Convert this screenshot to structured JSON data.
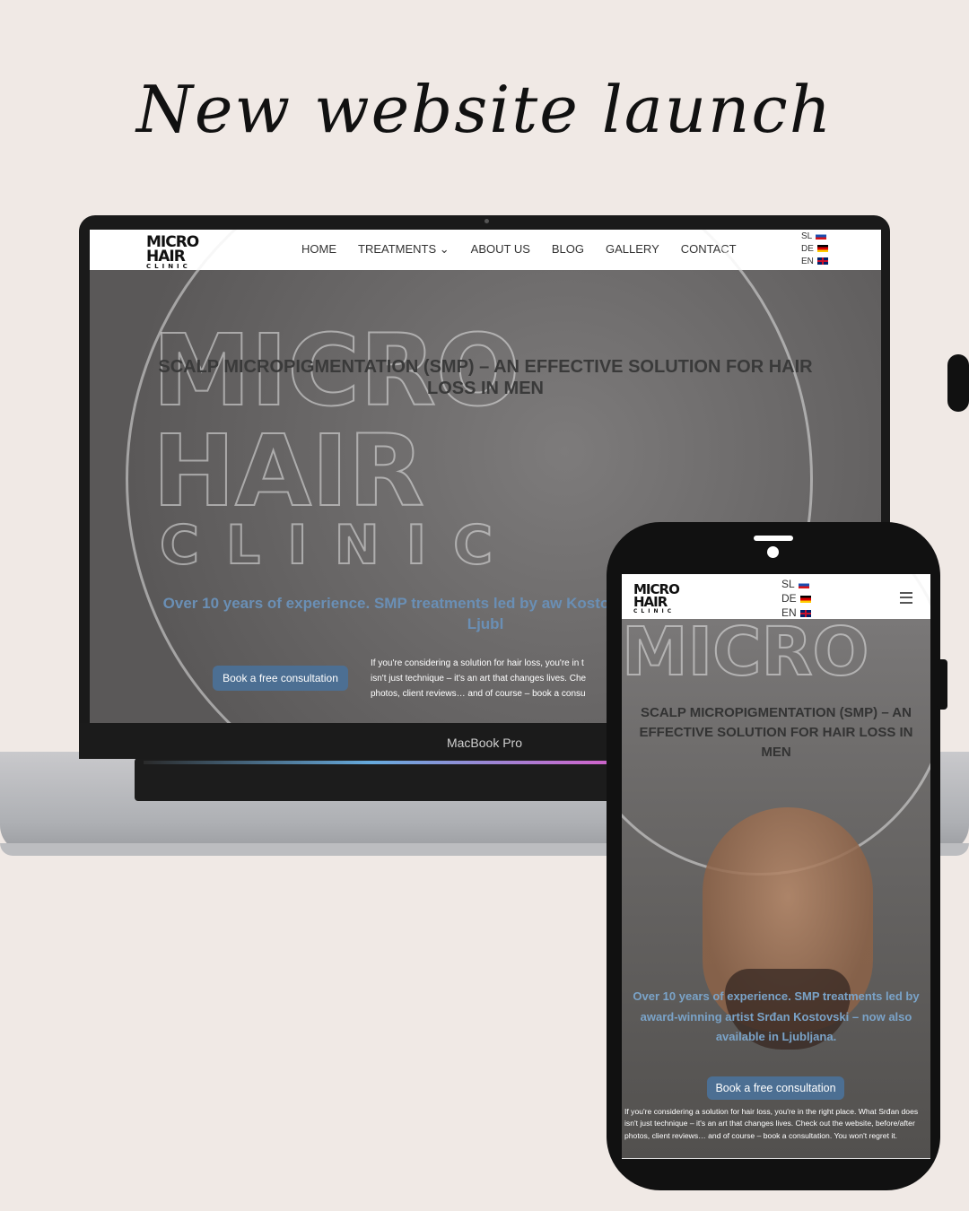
{
  "headline": "New website launch",
  "brand": {
    "line1": "MICRO",
    "line2": "HAIR",
    "line3": "CLINIC"
  },
  "desktop": {
    "nav": [
      {
        "label": "HOME"
      },
      {
        "label": "TREATMENTS ⌄"
      },
      {
        "label": "ABOUT US"
      },
      {
        "label": "BLOG"
      },
      {
        "label": "GALLERY"
      },
      {
        "label": "CONTACT"
      }
    ],
    "languages": [
      "SL",
      "DE",
      "EN"
    ],
    "hero_title": "SCALP MICROPIGMENTATION (SMP) – AN EFFECTIVE SOLUTION FOR HAIR LOSS IN MEN",
    "hero_subtitle": "Over 10 years of experience. SMP treatments led by aw Kostovski – now also available in Ljubl",
    "cta": "Book a free consultation",
    "body_line1": "If you're considering a solution for hair loss, you're in t",
    "body_line2": "isn't just technique – it's an art that changes lives. Che",
    "body_line3": "photos, client reviews… and of course – book a consu",
    "device_label": "MacBook Pro"
  },
  "mobile": {
    "languages": [
      "SL",
      "DE",
      "EN"
    ],
    "hero_title": "SCALP MICROPIGMENTATION (SMP) – AN EFFECTIVE SOLUTION FOR HAIR LOSS IN MEN",
    "hero_subtitle": "Over 10 years of experience. SMP treatments led by award-winning artist Srđan Kostovski – now also available in Ljubljana.",
    "cta": "Book a free consultation",
    "body": "If you're considering a solution for hair loss, you're in the right place. What Srđan does isn't just technique – it's an art that changes lives. Check out the website, before/after photos, client reviews… and of course – book a consultation. You won't regret it."
  }
}
